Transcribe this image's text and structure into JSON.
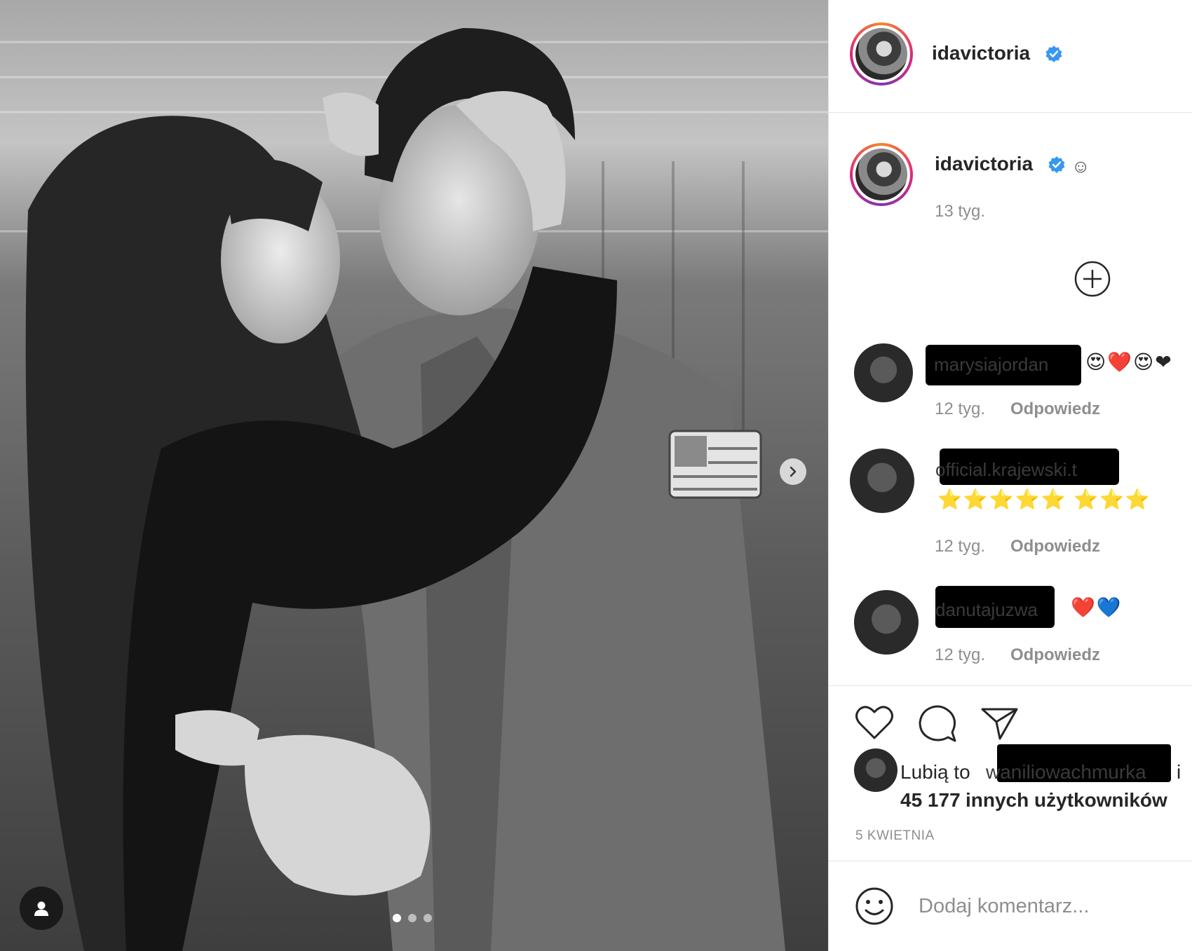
{
  "post": {
    "author": "idavictoria",
    "verified": true,
    "caption_emoji": "☺",
    "posted_ago": "13 tyg.",
    "carousel_dots": 3,
    "active_dot": 0
  },
  "comments": [
    {
      "username": "marysiajordan",
      "text": "😍❤️😍❤",
      "time": "12 tyg.",
      "reply": "Odpowiedz"
    },
    {
      "username": "official.krajewski.t",
      "text": "⭐⭐⭐⭐⭐ ⭐⭐⭐",
      "time": "12 tyg.",
      "reply": "Odpowiedz"
    },
    {
      "username": "danutajuzwa",
      "text": "❤️💙",
      "time": "12 tyg.",
      "reply": "Odpowiedz"
    }
  ],
  "likes": {
    "prefix": "Lubią to",
    "liker": "waniliowachmurka",
    "suffix": "i",
    "count_text": "45 177",
    "others_text": "innych użytkowników"
  },
  "date": "5 KWIETNIA",
  "add_comment_placeholder": "Dodaj komentarz...",
  "icons": [
    "add-icon",
    "heart-icon",
    "comment-icon",
    "share-icon",
    "smile-icon",
    "user-tag-icon",
    "next-arrow-icon",
    "verified-icon"
  ],
  "colors": {
    "verified": "#3897f0",
    "ring_start": "#f58529",
    "ring_end": "#dd2a7b",
    "muted": "#8e8e8e"
  }
}
